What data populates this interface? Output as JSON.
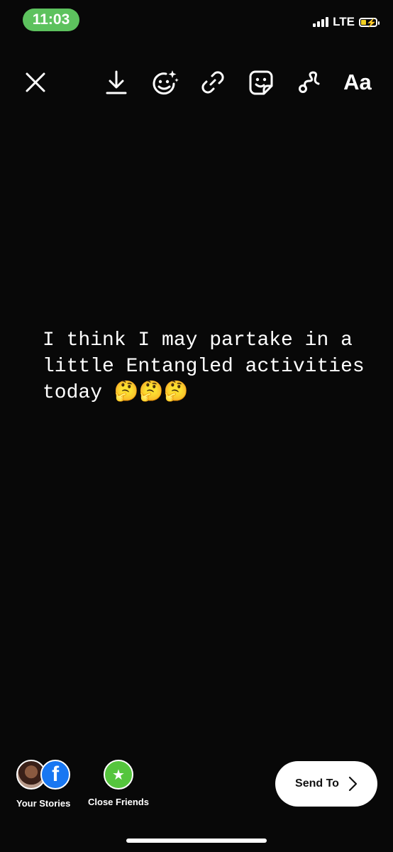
{
  "status_bar": {
    "time": "11:03",
    "network": "LTE",
    "battery_level": 0.35,
    "pill_color": "#5dc25e"
  },
  "toolbar": {
    "close_icon": "close-icon",
    "download_icon": "download-icon",
    "effects_icon": "face-effects-icon",
    "link_icon": "link-icon",
    "sticker_icon": "sticker-icon",
    "draw_icon": "draw-icon",
    "text_tool_label": "Aa"
  },
  "story": {
    "text": "I think I may partake in a little Entangled activities today 🤔🤔🤔"
  },
  "share": {
    "your_stories_label": "Your Stories",
    "close_friends_label": "Close Friends",
    "facebook_glyph": "f",
    "send_to_label": "Send To"
  },
  "colors": {
    "background": "#080808",
    "close_friends_green": "#55c53d",
    "facebook_blue": "#1877f2"
  }
}
